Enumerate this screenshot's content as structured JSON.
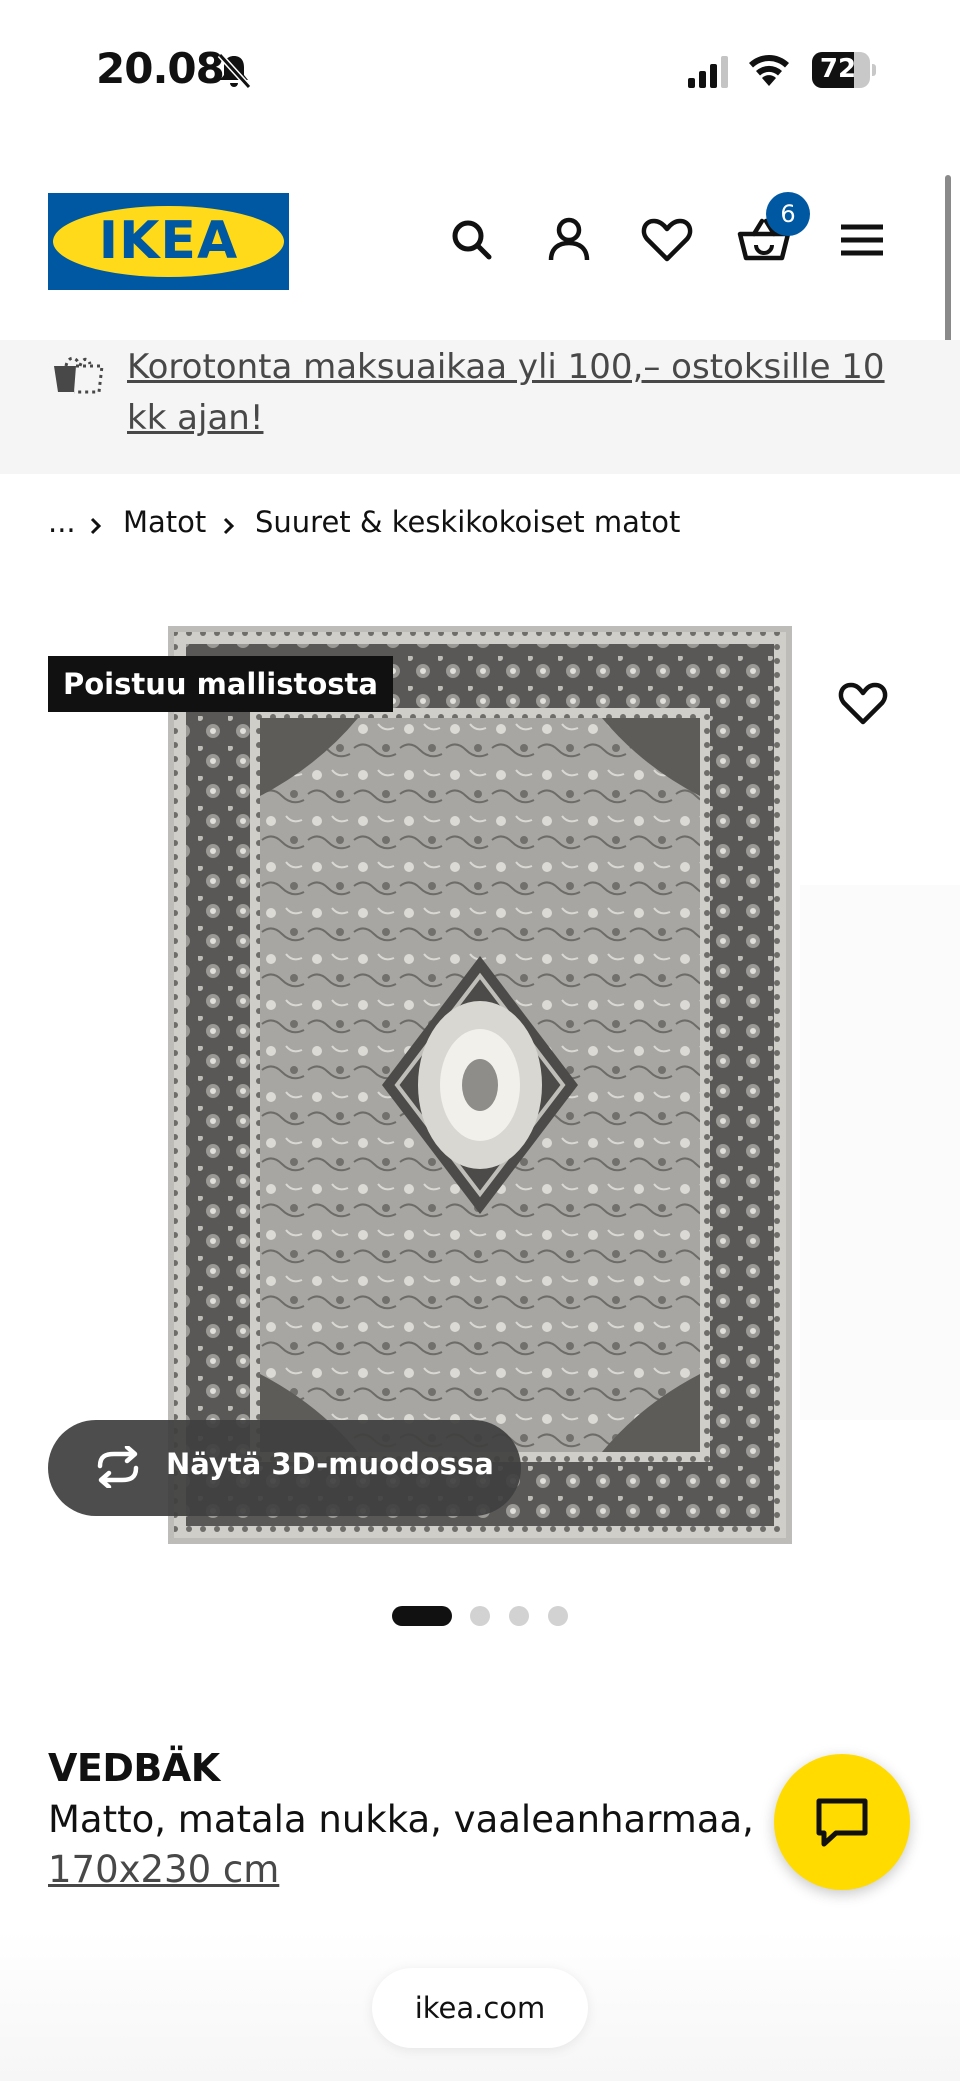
{
  "status_bar": {
    "time": "20.08",
    "battery_level": 72,
    "battery_label": "72"
  },
  "header": {
    "logo_text": "IKEA",
    "cart_count": "6",
    "brand_colors": {
      "blue": "#0058a3",
      "yellow": "#ffda1a"
    },
    "icons": [
      "search-icon",
      "account-icon",
      "heart-icon",
      "basket-icon",
      "menu-icon"
    ]
  },
  "banner": {
    "text": "Korotonta maksuaikaa yli 100,– ostoksille 10 kk ajan!"
  },
  "breadcrumb": {
    "ellipsis": "...",
    "items": [
      "Matot",
      "Suuret & keskikokoiset matot"
    ]
  },
  "product": {
    "badge": "Poistuu mallistosta",
    "view_3d_label": "Näytä 3D-muodossa",
    "name": "VEDBÄK",
    "description": "Matto, matala nukka, vaaleanharmaa,",
    "size": "170x230 cm",
    "carousel": {
      "count": 4,
      "active_index": 0
    }
  },
  "footer": {
    "url": "ikea.com"
  }
}
